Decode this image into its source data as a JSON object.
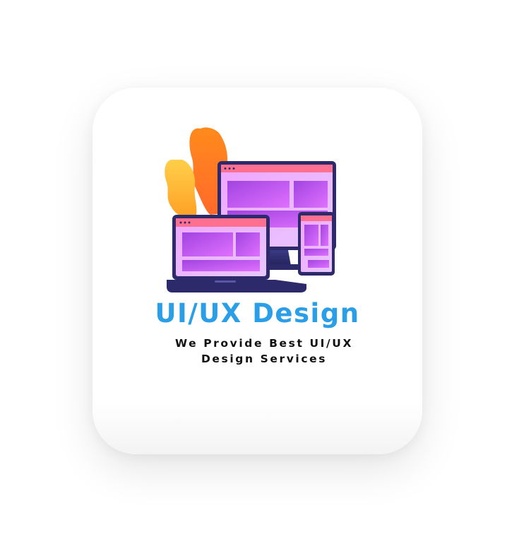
{
  "card": {
    "title": "UI/UX Design",
    "subtitle": "We Provide Best UI/UX Design Services"
  },
  "illustration": {
    "icon": "responsive-devices-illustration",
    "colors": {
      "title": "#2a9ee6",
      "device_frame": "#2c2a6b",
      "screen_header": "#ff6f8f",
      "screen_content": "#c255e6",
      "plant_orange": "#ff8a1c",
      "plant_yellow": "#ffc23d"
    }
  }
}
